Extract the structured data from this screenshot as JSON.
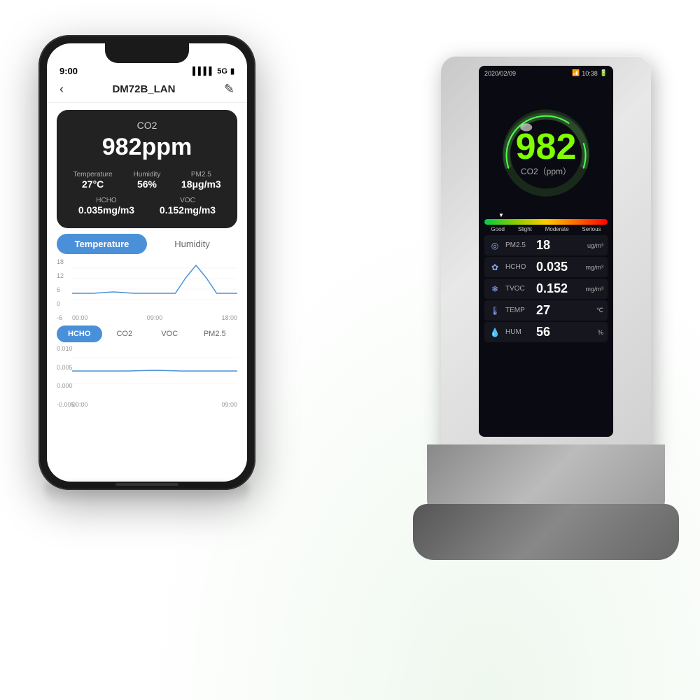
{
  "phone": {
    "status_time": "9:00",
    "signal": "▌▌▌▌",
    "network": "5G",
    "battery": "🔋",
    "nav_title": "DM72B_LAN",
    "back_icon": "‹",
    "edit_icon": "✎",
    "co2_label": "CO2",
    "co2_value": "982ppm",
    "temp_label": "Temperature",
    "temp_value": "27°C",
    "humidity_label": "Humidity",
    "humidity_value": "56%",
    "pm25_label": "PM2.5",
    "pm25_value": "18μg/m3",
    "hcho_label": "HCHO",
    "hcho_value": "0.035mg/m3",
    "voc_label": "VOC",
    "voc_value": "0.152mg/m3",
    "tab_temp": "Temperature",
    "tab_humidity": "Humidity",
    "chart_y": [
      "18",
      "12",
      "6",
      "0",
      "-6"
    ],
    "chart_x": [
      "00:00",
      "09:00",
      "18:00"
    ],
    "btab_hcho": "HCHO",
    "btab_co2": "CO2",
    "btab_voc": "VOC",
    "btab_pm25": "PM2.5",
    "chart2_y": [
      "0.010",
      "0.005",
      "0.000",
      "-0.005"
    ],
    "chart2_x": [
      "00:00",
      "09:00"
    ]
  },
  "device": {
    "date": "2020/02/09",
    "wifi_icon": "wifi",
    "time": "10:38",
    "battery_icon": "battery",
    "co2_value": "982",
    "co2_unit": "CO2（ppm）",
    "bar_labels": [
      "Good",
      "Slight",
      "Moderate",
      "Serious"
    ],
    "rows": [
      {
        "icon": "◎",
        "name": "PM2.5",
        "value": "18",
        "unit": "ug/m³"
      },
      {
        "icon": "✿",
        "name": "HCHO",
        "value": "0.035",
        "unit": "mg/m³"
      },
      {
        "icon": "❄",
        "name": "TVOC",
        "value": "0.152",
        "unit": "mg/m³"
      },
      {
        "icon": "🌡",
        "name": "TEMP",
        "value": "27",
        "unit": "℃"
      },
      {
        "icon": "💧",
        "name": "HUM",
        "value": "56",
        "unit": "%"
      }
    ]
  }
}
